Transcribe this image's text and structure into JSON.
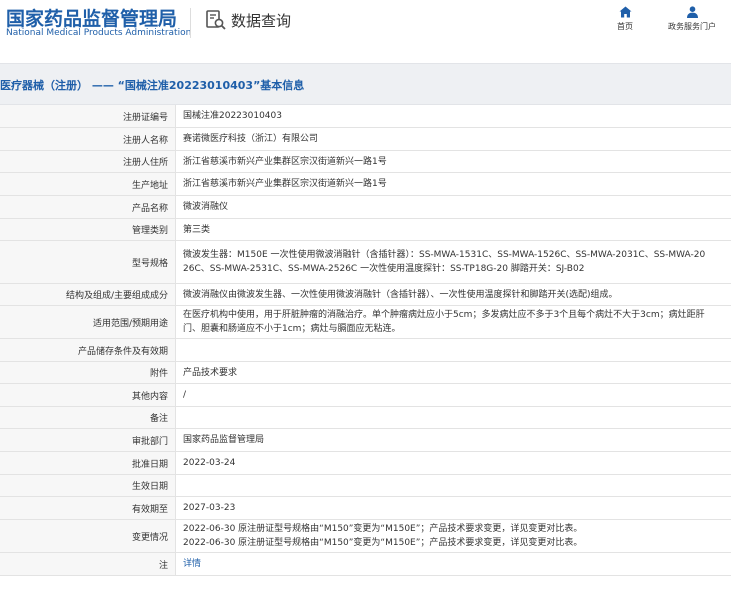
{
  "header": {
    "logo_cn": "国家药品监督管理局",
    "logo_en": "National Medical Products Administration",
    "query_title": "数据查询",
    "nav_home": "首页",
    "nav_portal": "政务服务门户"
  },
  "page_title": "医疗器械（注册） —— “国械注准20223010403”基本信息",
  "rows": [
    {
      "label": "注册证编号",
      "lines": [
        "国械注准20223010403"
      ]
    },
    {
      "label": "注册人名称",
      "lines": [
        "赛诺微医疗科技（浙江）有限公司"
      ]
    },
    {
      "label": "注册人住所",
      "lines": [
        "浙江省慈溪市新兴产业集群区宗汉街道新兴一路1号"
      ]
    },
    {
      "label": "生产地址",
      "lines": [
        "浙江省慈溪市新兴产业集群区宗汉街道新兴一路1号"
      ]
    },
    {
      "label": "产品名称",
      "lines": [
        "微波消融仪"
      ]
    },
    {
      "label": "管理类别",
      "lines": [
        "第三类"
      ]
    },
    {
      "label": "型号规格",
      "lines": [
        "微波发生器：M150E 一次性使用微波消融针（含插针器）：SS-MWA-1531C、SS-MWA-1526C、SS-MWA-2031C、SS-MWA-20",
        "26C、SS-MWA-2531C、SS-MWA-2526C 一次性使用温度探针：SS-TP18G-20 脚踏开关：SJ-B02"
      ]
    },
    {
      "label": "结构及组成/主要组成成分",
      "lines": [
        "微波消融仪由微波发生器、一次性使用微波消融针（含插针器）、一次性使用温度探针和脚踏开关(选配)组成。"
      ]
    },
    {
      "label": "适用范围/预期用途",
      "lines": [
        "在医疗机构中使用，用于肝脏肿瘤的消融治疗。单个肿瘤病灶应小于5cm；多发病灶应不多于3个且每个病灶不大于3cm；病灶距肝",
        "门、胆囊和肠道应不小于1cm；病灶与膈面应无粘连。"
      ]
    },
    {
      "label": "产品储存条件及有效期",
      "lines": [
        ""
      ]
    },
    {
      "label": "附件",
      "lines": [
        "产品技术要求"
      ]
    },
    {
      "label": "其他内容",
      "lines": [
        "/"
      ]
    },
    {
      "label": "备注",
      "lines": [
        ""
      ]
    },
    {
      "label": "审批部门",
      "lines": [
        "国家药品监督管理局"
      ]
    },
    {
      "label": "批准日期",
      "lines": [
        "2022-03-24"
      ]
    },
    {
      "label": "生效日期",
      "lines": [
        ""
      ]
    },
    {
      "label": "有效期至",
      "lines": [
        "2027-03-23"
      ]
    },
    {
      "label": "变更情况",
      "lines": [
        "2022-06-30 原注册证型号规格由“M150”变更为“M150E”；产品技术要求变更，详见变更对比表。",
        "2022-06-30 原注册证型号规格由“M150”变更为“M150E”；产品技术要求变更，详见变更对比表。"
      ]
    },
    {
      "label": "注",
      "lines": [],
      "link": "详情"
    }
  ],
  "colors": {
    "brand": "#1f5fa9",
    "label_bg": "#f7f7f7",
    "titlebar_bg": "#eef0f3"
  }
}
